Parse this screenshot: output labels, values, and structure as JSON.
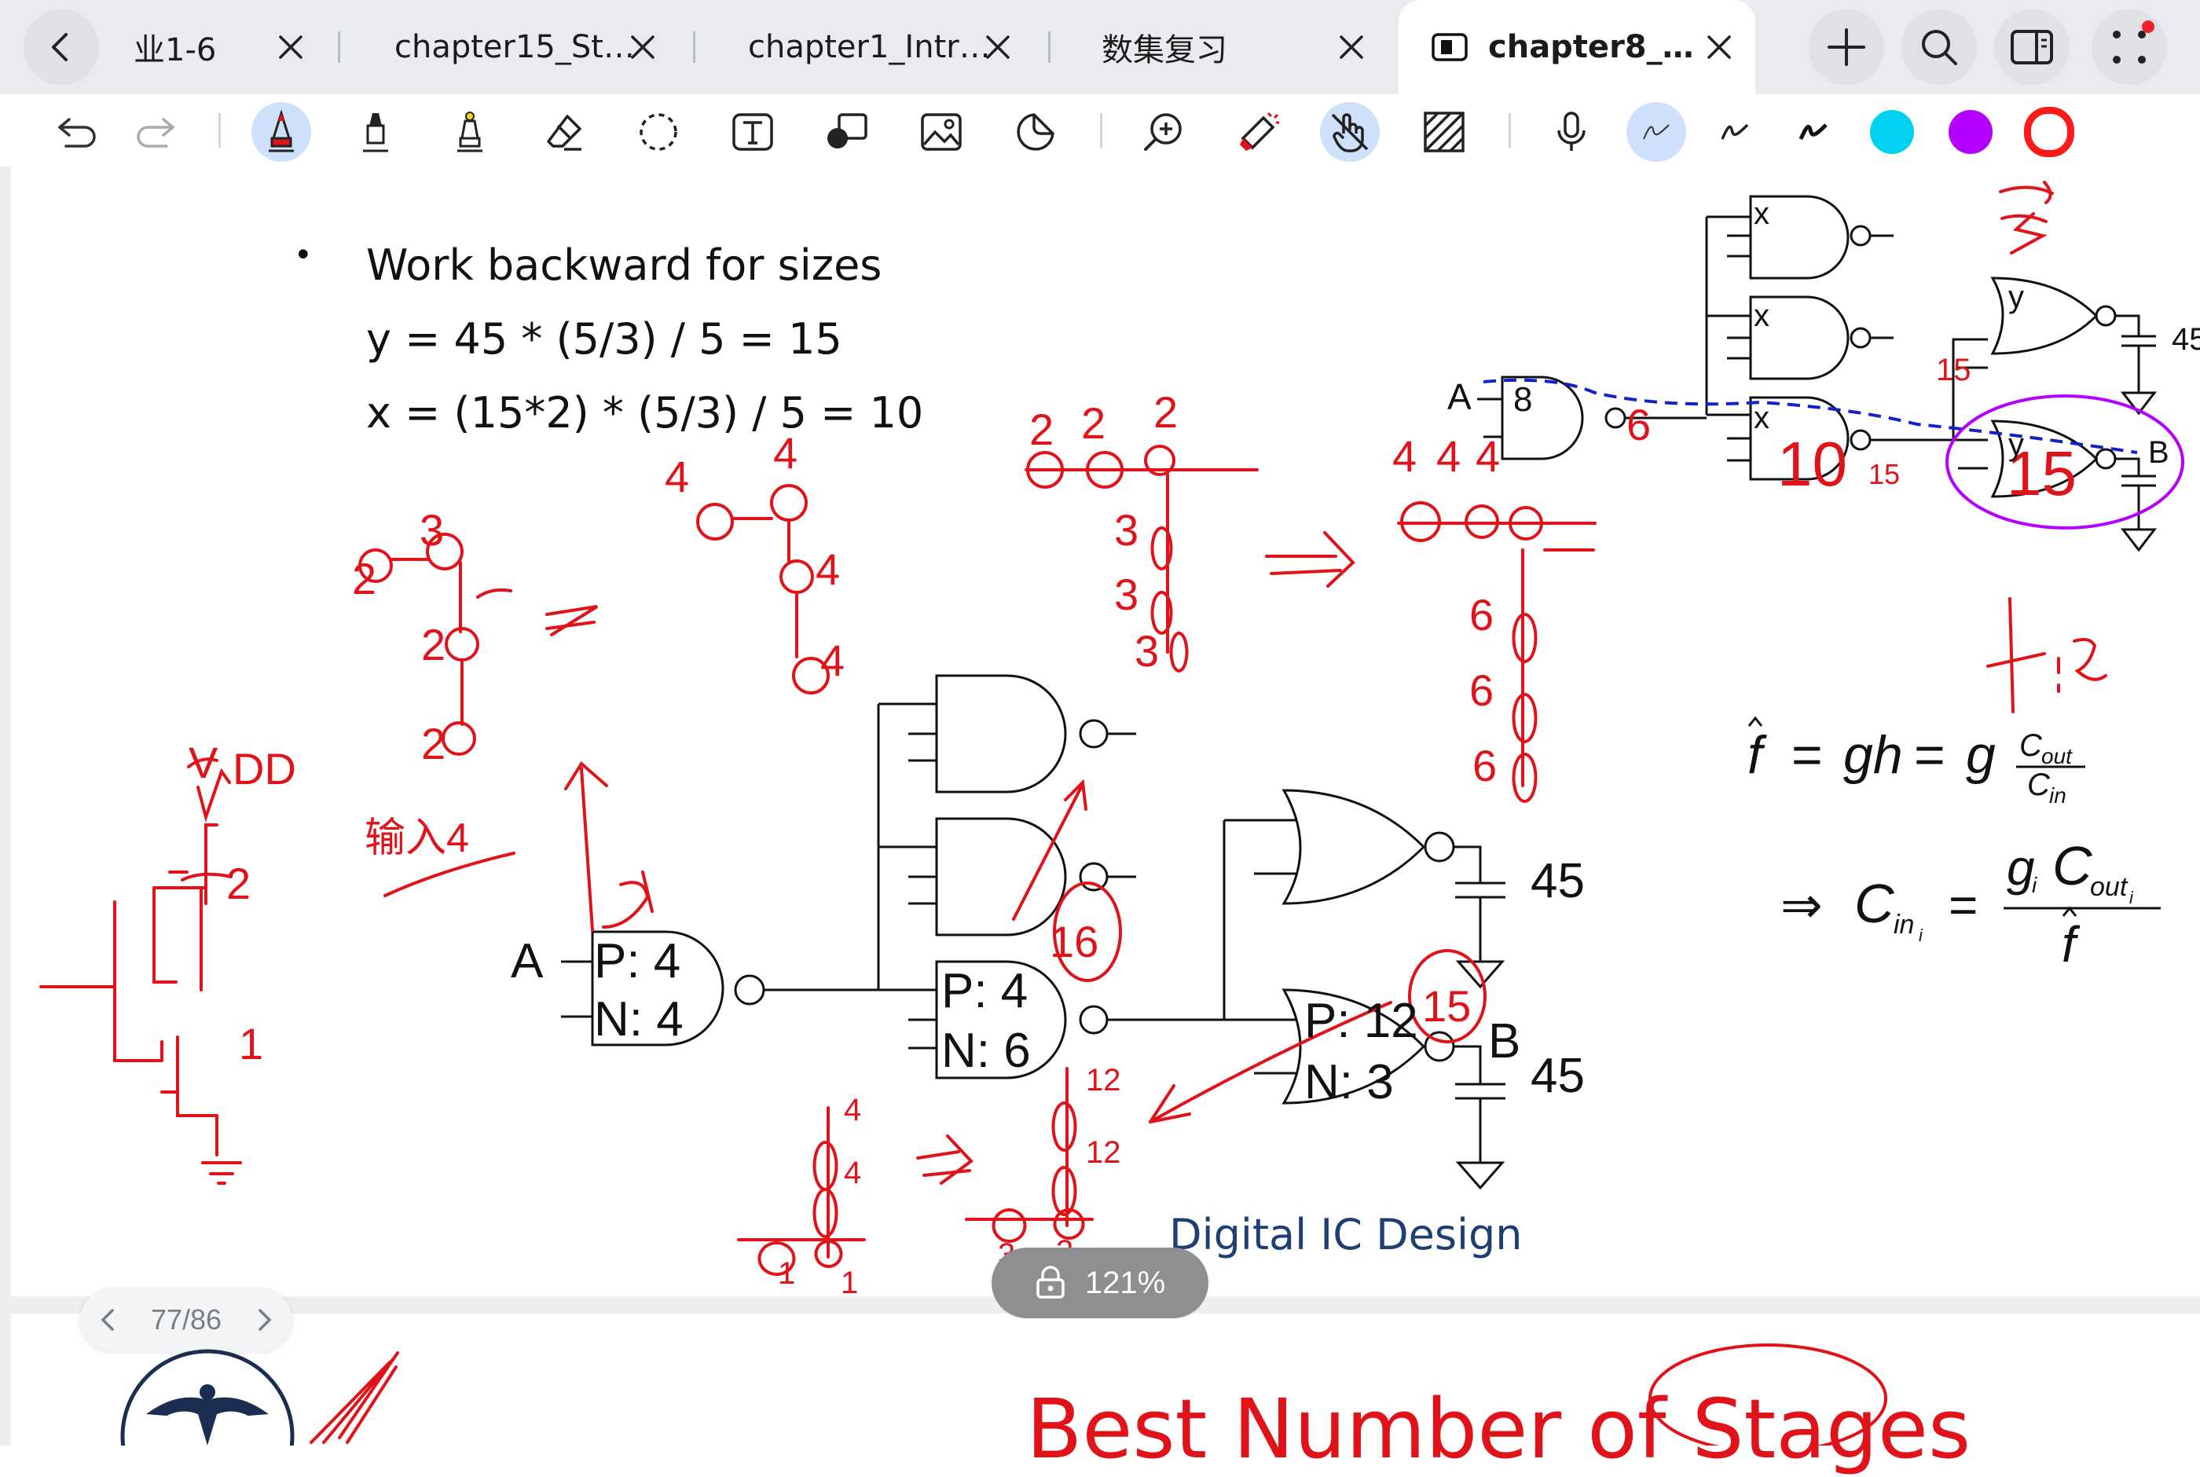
{
  "tabs": [
    {
      "label": "业1-6",
      "active": false
    },
    {
      "label": "chapter15_St…",
      "active": false
    },
    {
      "label": "chapter1_Intr…",
      "active": false
    },
    {
      "label": "数集复习",
      "active": false
    },
    {
      "label": "chapter8_…",
      "active": true
    }
  ],
  "toolbar": {
    "tools": [
      "undo-icon",
      "redo-icon",
      "pen-icon",
      "marker-icon",
      "highlighter-icon",
      "eraser-icon",
      "lasso-icon",
      "text-icon",
      "shapes-icon",
      "image-icon",
      "sticker-icon",
      "zoom-icon",
      "laser-icon",
      "touch-icon",
      "pattern-icon",
      "mic-icon"
    ],
    "colors": [
      "#00d2f0",
      "#b400ff",
      "#ff1a1a"
    ]
  },
  "slide": {
    "bullet": "Work backward for sizes",
    "eq1": "y = 45 * (5/3) / 5 = 15",
    "eq2": "x = (15*2) * (5/3) / 5 = 10",
    "gate_a_label": "A",
    "gate1_p": "P: 4",
    "gate1_n": "N: 4",
    "gate2_p": "P: 4",
    "gate2_n": "N: 6",
    "gate3_p": "P: 12",
    "gate3_n": "N: 3",
    "load_top": "45",
    "load_bottom": "45",
    "out_b_label": "B",
    "mini_a": "A",
    "mini_8": "8",
    "mini_x": "x",
    "mini_y": "y",
    "mini_b": "B",
    "mini_45": "45",
    "footer": "Digital IC Design",
    "next_title": "Best Number of Stages"
  },
  "viewer": {
    "zoom": "121%",
    "page_indicator": "77/86"
  }
}
